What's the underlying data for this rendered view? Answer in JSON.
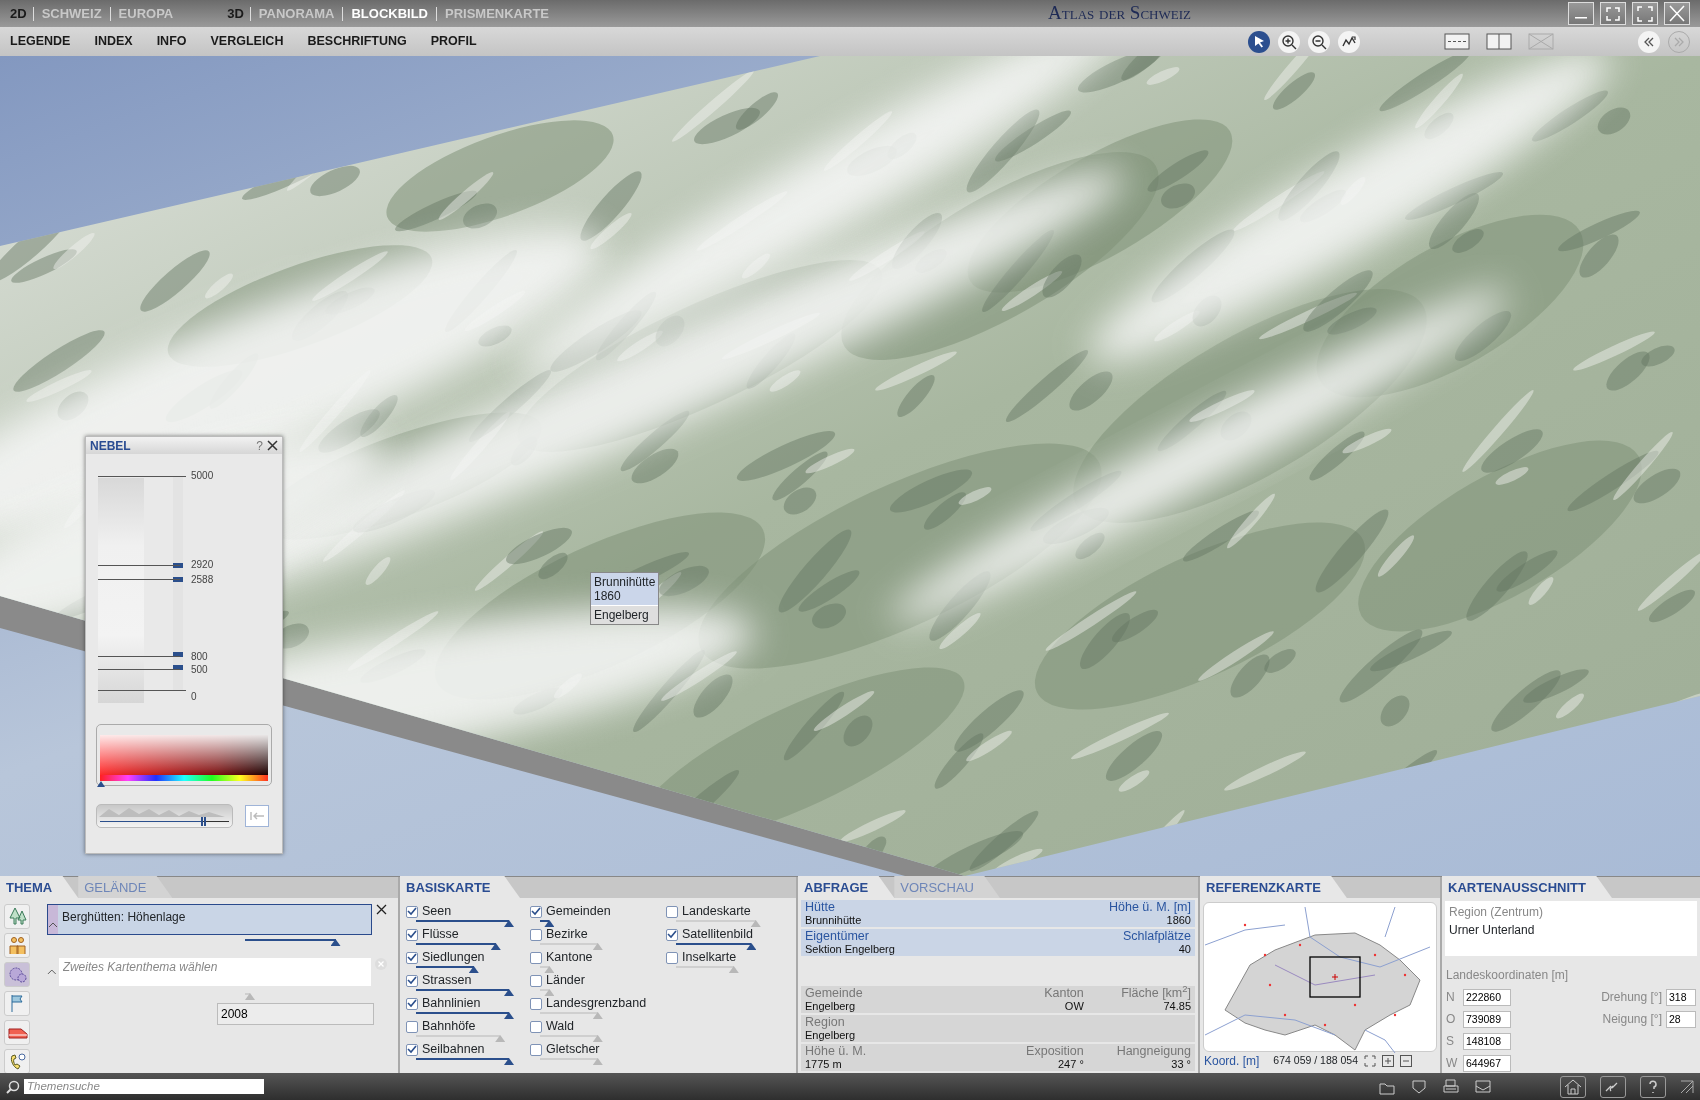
{
  "top_bar": {
    "groups": [
      {
        "label": "2D",
        "items": [
          {
            "label": "SCHWEIZ",
            "selected": false
          },
          {
            "label": "EUROPA",
            "selected": false
          }
        ]
      },
      {
        "label": "3D",
        "items": [
          {
            "label": "PANORAMA",
            "selected": false
          },
          {
            "label": "BLOCKBILD",
            "selected": true
          },
          {
            "label": "PRISMENKARTE",
            "selected": false
          }
        ]
      }
    ],
    "title": "Atlas der Schweiz"
  },
  "menu": [
    "LEGENDE",
    "INDEX",
    "INFO",
    "VERGLEICH",
    "BESCHRIFTUNG",
    "PROFIL"
  ],
  "tools": [
    {
      "kind": "pointer",
      "selected": true
    },
    {
      "kind": "zoom_in",
      "selected": false
    },
    {
      "kind": "zoom_out",
      "selected": false
    },
    {
      "kind": "profile",
      "selected": false
    }
  ],
  "layouts": [
    {
      "kind": "split_horizontal",
      "disabled": false
    },
    {
      "kind": "split_vertical",
      "disabled": false
    },
    {
      "kind": "crossed",
      "disabled": true
    }
  ],
  "history": [
    {
      "kind": "back",
      "disabled": false
    },
    {
      "kind": "forward",
      "disabled": true
    }
  ],
  "map": {
    "tooltip": {
      "name": "Brunnihütte",
      "value": "1860",
      "place": "Engelberg"
    }
  },
  "fog_panel": {
    "title": "NEBEL",
    "help": "?",
    "scale": [
      {
        "label": "5000",
        "handle": false,
        "level": 1
      },
      {
        "label": "2920",
        "handle": true,
        "level": 0.584
      },
      {
        "label": "2588",
        "handle": true,
        "level": 0.518
      },
      {
        "label": "800",
        "handle": true,
        "level": 0.16
      },
      {
        "label": "500",
        "handle": true,
        "level": 0.1
      },
      {
        "label": "0",
        "handle": false,
        "level": 0
      }
    ],
    "slider": {
      "level": 0.8
    }
  },
  "thema": {
    "tabs": [
      {
        "label": "THEMA",
        "selected": true
      },
      {
        "label": "GELÄNDE",
        "selected": false
      }
    ],
    "categories": [
      {
        "kind": "trees",
        "selected": false
      },
      {
        "kind": "people",
        "selected": false
      },
      {
        "kind": "gears",
        "selected": true
      },
      {
        "kind": "flag",
        "selected": false
      },
      {
        "kind": "train",
        "selected": false
      },
      {
        "kind": "phone",
        "selected": false
      }
    ],
    "first_theme": {
      "value": "Berghütten: Höhenlage",
      "level": 0.9
    },
    "second_theme": {
      "placeholder": "Zweites Kartenthema wählen",
      "level": 0
    },
    "year": "2008"
  },
  "basiskarte": {
    "title": "BASISKARTE",
    "columns": [
      [
        {
          "label": "Seen",
          "checked": true,
          "level": 1
        },
        {
          "label": "Flüsse",
          "checked": true,
          "level": 0.85
        },
        {
          "label": "Siedlungen",
          "checked": true,
          "level": 0.6
        },
        {
          "label": "Strassen",
          "checked": true,
          "level": 1
        },
        {
          "label": "Bahnlinien",
          "checked": true,
          "level": 1
        },
        {
          "label": "Bahnhöfe",
          "checked": false,
          "level": 0.9
        },
        {
          "label": "Seilbahnen",
          "checked": true,
          "level": 1
        }
      ],
      [
        {
          "label": "Gemeinden",
          "checked": true,
          "level": 0.05
        },
        {
          "label": "Bezirke",
          "checked": false,
          "level": 0.6
        },
        {
          "label": "Kantone",
          "checked": false,
          "level": 0.05
        },
        {
          "label": "Länder",
          "checked": false,
          "level": 0.05
        },
        {
          "label": "Landesgrenzband",
          "checked": false,
          "level": 0.6
        },
        {
          "label": "Wald",
          "checked": false,
          "level": 0.6
        },
        {
          "label": "Gletscher",
          "checked": false,
          "level": 0.6
        }
      ],
      [
        {
          "label": "Landeskarte",
          "checked": false,
          "level": 0.85
        },
        {
          "label": "Satellitenbild",
          "checked": true,
          "level": 0.8
        },
        {
          "label": "Inselkarte",
          "checked": false,
          "level": 0.6
        }
      ]
    ]
  },
  "abfrage": {
    "tabs": [
      {
        "label": "ABFRAGE",
        "selected": true
      },
      {
        "label": "VORSCHAU",
        "selected": false
      }
    ],
    "rows": [
      {
        "kind": "object",
        "fields": [
          {
            "label": "Hütte",
            "value": "Brunnihütte"
          },
          {
            "label": "Höhe ü. M. [m]",
            "value": "1860"
          }
        ]
      },
      {
        "kind": "object",
        "fields": [
          {
            "label": "Eigentümer",
            "value": "Sektion Engelberg"
          },
          {
            "label": "Schlafplätze",
            "value": "40"
          }
        ]
      },
      {
        "kind": "place",
        "fields": [
          {
            "label": "Gemeinde",
            "value": "Engelberg"
          },
          {
            "label": "Kanton",
            "value": "OW"
          },
          {
            "label": "Fläche [km$^{2}$]",
            "value": "74.85"
          }
        ]
      },
      {
        "kind": "place",
        "fields": [
          {
            "label": "Region",
            "value": "Engelberg"
          }
        ]
      },
      {
        "kind": "place",
        "fields": [
          {
            "label": "Höhe ü. M.",
            "value": "1775 m"
          },
          {
            "label": "Exposition",
            "value": "247 °"
          },
          {
            "label": "Hangneigung",
            "value": "33 °"
          }
        ]
      }
    ]
  },
  "referenzkarte": {
    "title": "REFERENZKARTE",
    "coord_label": "Koord. [m]",
    "coord_value": "674 059 / 188 054"
  },
  "kartenausschnitt": {
    "title": "KARTENAUSSCHNITT",
    "region_label": "Region (Zentrum)",
    "region": "Urner Unterland",
    "coord_title": "Landeskoordinaten [m]",
    "coords": [
      {
        "label": "N",
        "value": "222860"
      },
      {
        "label": "O",
        "value": "739089"
      },
      {
        "label": "S",
        "value": "148108"
      },
      {
        "label": "W",
        "value": "644967"
      }
    ],
    "view": [
      {
        "label": "Drehung [°]",
        "value": "318"
      },
      {
        "label": "Neigung [°]",
        "value": "28"
      }
    ]
  },
  "status_bar": {
    "search_placeholder": "Themensuche"
  }
}
